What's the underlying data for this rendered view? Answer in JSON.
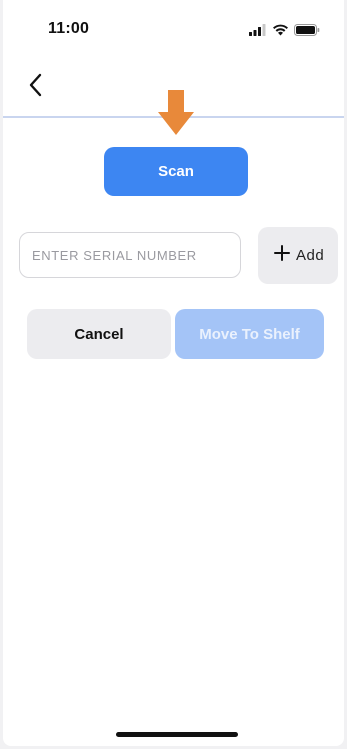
{
  "status_bar": {
    "time": "11:00",
    "icons": [
      "cellular-signal-icon",
      "wifi-icon",
      "battery-icon"
    ]
  },
  "nav": {
    "back_icon": "chevron-left-icon"
  },
  "annotation": {
    "arrow_icon": "down-arrow-icon",
    "arrow_color": "#e8893a"
  },
  "scan": {
    "label": "Scan",
    "color": "#3d86f2"
  },
  "serial": {
    "placeholder": "ENTER SERIAL NUMBER",
    "value": ""
  },
  "add": {
    "icon": "plus-icon",
    "label": "Add"
  },
  "actions": {
    "cancel_label": "Cancel",
    "move_label": "Move To Shelf",
    "move_color": "#a4c4f7"
  }
}
